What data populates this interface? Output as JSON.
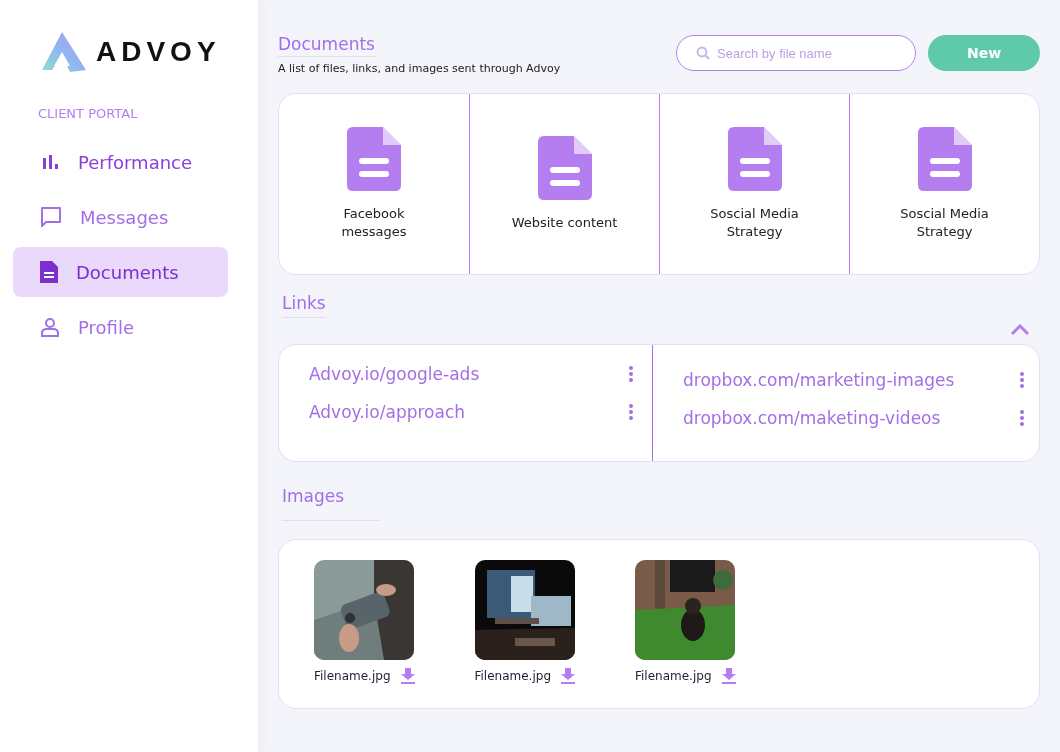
{
  "sidebar": {
    "logo": "ADVOY",
    "section_label": "CLIENT PORTAL",
    "items": [
      {
        "label": "Performance",
        "kind": "chart",
        "selected": false
      },
      {
        "label": "Messages",
        "kind": "message",
        "selected": false
      },
      {
        "label": "Documents",
        "kind": "document",
        "selected": true
      },
      {
        "label": "Profile",
        "kind": "person",
        "selected": false
      }
    ]
  },
  "header": {
    "title": "Documents",
    "subtitle": "A list of files, links, and images sent through Advoy",
    "search": {
      "placeholder": "Search by file name"
    },
    "new_button": "New"
  },
  "documents": [
    {
      "name": "Facebook messages"
    },
    {
      "name": "Website content"
    },
    {
      "name": "Soscial Media Strategy"
    },
    {
      "name": "Soscial Media Strategy"
    }
  ],
  "links": {
    "title": "Links",
    "expanded": true,
    "columns": [
      [
        "Advoy.io/google-ads",
        "Advoy.io/approach"
      ],
      [
        "dropbox.com/marketing-images",
        "dropbox.com/maketing-videos"
      ]
    ]
  },
  "images": {
    "title": "Images",
    "items": [
      {
        "filename": "Filename.jpg",
        "kind": "picture"
      },
      {
        "filename": "Filename.jpg",
        "kind": "picture"
      },
      {
        "filename": "Filename.jpg",
        "kind": "picture"
      }
    ]
  }
}
